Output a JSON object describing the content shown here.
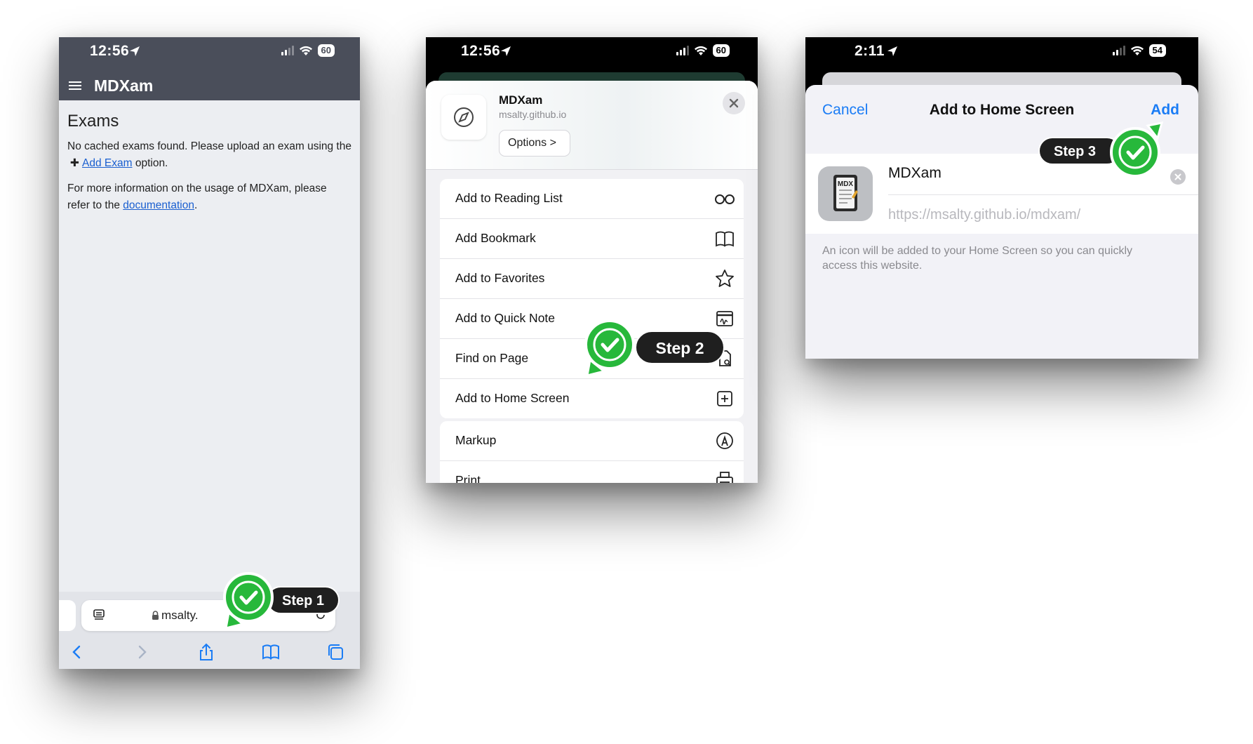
{
  "panel1": {
    "status": {
      "time": "12:56",
      "battery": "60"
    },
    "app_title": "MDXam",
    "heading": "Exams",
    "msg1_pre": "No cached exams found. Please upload an exam using the",
    "msg1_link": "Add Exam",
    "msg1_post": "option.",
    "msg2_pre": "For more information on the usage of MDXam, please refer to the",
    "msg2_link": "documentation",
    "msg2_post": ".",
    "url": "msalty.",
    "step_label": "Step 1",
    "icons": [
      "menu-icon",
      "location-arrow-icon",
      "signal-icon",
      "wifi-icon",
      "battery-icon",
      "reader-icon",
      "lock-icon",
      "reload-icon",
      "back-icon",
      "forward-icon",
      "share-icon",
      "bookmarks-icon",
      "tabs-icon",
      "checkmark-icon"
    ]
  },
  "panel2": {
    "status": {
      "time": "12:56",
      "battery": "60"
    },
    "site_title": "MDXam",
    "site_url": "msalty.github.io",
    "options_label": "Options >",
    "group1": [
      {
        "label": "Add to Reading List",
        "icon": "glasses-icon"
      },
      {
        "label": "Add Bookmark",
        "icon": "book-icon"
      },
      {
        "label": "Add to Favorites",
        "icon": "star-icon"
      },
      {
        "label": "Add to Quick Note",
        "icon": "quick-note-icon"
      },
      {
        "label": "Find on Page",
        "icon": "find-icon"
      },
      {
        "label": "Add to Home Screen",
        "icon": "add-square-icon"
      }
    ],
    "group2": [
      {
        "label": "Markup",
        "icon": "markup-icon"
      },
      {
        "label": "Print",
        "icon": "print-icon"
      }
    ],
    "step_label": "Step 2"
  },
  "panel3": {
    "status": {
      "time": "2:11",
      "battery": "54"
    },
    "cancel_label": "Cancel",
    "title": "Add to Home Screen",
    "add_label": "Add",
    "app_name": "MDXam",
    "app_url": "https://msalty.github.io/mdxam/",
    "hint": "An icon will be added to your Home Screen so you can quickly access this website.",
    "icon_text": "MDX",
    "step_label": "Step 3"
  },
  "colors": {
    "accent": "#1a7cf5",
    "step_green": "#27b83b",
    "link": "#1a5fd0",
    "toolbar": "#4a4e5a"
  }
}
